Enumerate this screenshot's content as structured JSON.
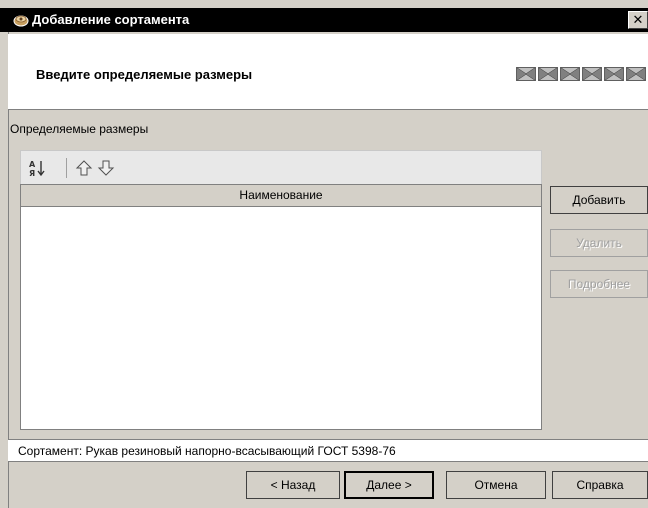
{
  "window": {
    "title": "Добавление сортамента",
    "close_label": "✕"
  },
  "header": {
    "instruction": "Введите определяемые размеры",
    "step_count": 6
  },
  "section": {
    "label": "Определяемые размеры"
  },
  "toolbar": {
    "buttons": [
      "sort-icon",
      "move-up-icon",
      "move-down-icon"
    ]
  },
  "table": {
    "columns": [
      "Наименование"
    ],
    "rows": []
  },
  "side_buttons": {
    "add": "Добавить",
    "delete": "Удалить",
    "details": "Подробнее"
  },
  "status": {
    "text": "Сортамент: Рукав резиновый напорно-всасывающий ГОСТ 5398-76"
  },
  "footer": {
    "back": "< Назад",
    "next": "Далее >",
    "cancel": "Отмена",
    "help": "Справка"
  }
}
